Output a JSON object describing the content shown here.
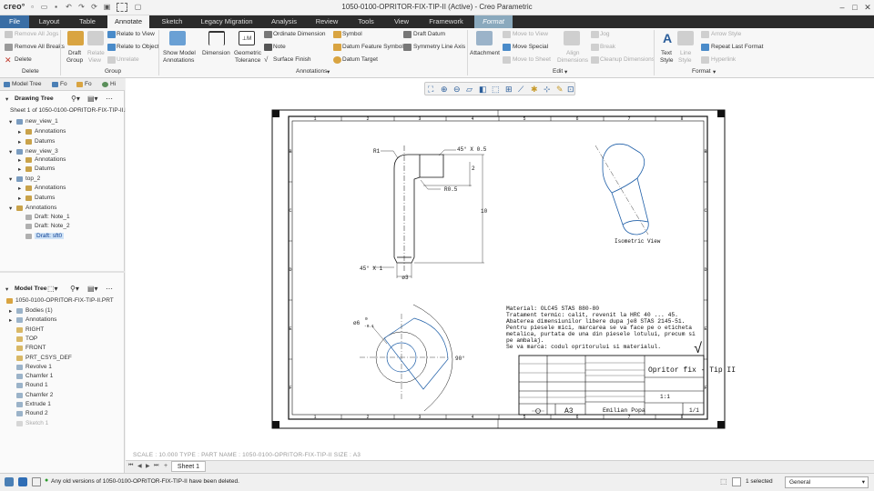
{
  "app": {
    "logo": "creo°",
    "window_title": "1050-0100-OPRITOR-FIX-TIP-II (Active) - Creo Parametric"
  },
  "tabs": [
    "File",
    "Layout",
    "Table",
    "Annotate",
    "Sketch",
    "Legacy Migration",
    "Analysis",
    "Review",
    "Tools",
    "View",
    "Framework",
    "Format"
  ],
  "ribbon": {
    "delete_group": {
      "remove_all_jogs": "Remove All Jogs",
      "remove_all_breaks": "Remove All Breaks",
      "delete": "Delete",
      "label": "Delete"
    },
    "group_group": {
      "draft_group": "Draft",
      "draft_group2": "Group",
      "relate_view": "Relate",
      "relate_view2": "View",
      "relate_to_view": "Relate to View",
      "relate_to_object": "Relate to Object",
      "unrelate": "Unrelate",
      "label": "Group"
    },
    "annotations_group": {
      "show_model": "Show Model",
      "show_model2": "Annotations",
      "dimension": "Dimension",
      "geometric": "Geometric",
      "geometric2": "Tolerance",
      "ordinate_dimension": "Ordinate Dimension",
      "note": "Note",
      "surface_finish": "Surface Finish",
      "symbol": "Symbol",
      "datum_feature_symbol": "Datum Feature Symbol",
      "datum_target": "Datum Target",
      "draft_datum": "Draft Datum",
      "symmetry_line_axis": "Symmetry Line Axis",
      "label": "Annotations"
    },
    "edit_group": {
      "attachment": "Attachment",
      "move_to_view": "Move to View",
      "move_special": "Move Special",
      "move_to_sheet": "Move to Sheet",
      "align": "Align",
      "align2": "Dimensions",
      "jog": "Jog",
      "break": "Break",
      "cleanup_dimensions": "Cleanup Dimensions",
      "label": "Edit"
    },
    "format_group": {
      "text_style": "Text",
      "text_style2": "Style",
      "line_style": "Line",
      "line_style2": "Style",
      "arrow_style": "Arrow Style",
      "repeat_last_format": "Repeat Last Format",
      "hyperlink": "Hyperlink",
      "label": "Format"
    }
  },
  "left_tabs": [
    "Model Tree",
    "Fo",
    "Fo",
    "Hi"
  ],
  "drawing_tree": {
    "title": "Drawing Tree",
    "sheet": "Sheet 1 of 1050-0100-OPRITOR-FIX-TIP-II.DF",
    "items": [
      {
        "label": "new_view_1",
        "indent": 1
      },
      {
        "label": "Annotations",
        "indent": 2
      },
      {
        "label": "Datums",
        "indent": 2
      },
      {
        "label": "new_view_3",
        "indent": 1
      },
      {
        "label": "Annotations",
        "indent": 2
      },
      {
        "label": "Datums",
        "indent": 2
      },
      {
        "label": "top_2",
        "indent": 1
      },
      {
        "label": "Annotations",
        "indent": 2
      },
      {
        "label": "Datums",
        "indent": 2
      },
      {
        "label": "Annotations",
        "indent": 0
      },
      {
        "label": "Draft: Note_1",
        "indent": 2
      },
      {
        "label": "Draft: Note_2",
        "indent": 2
      },
      {
        "label": "Draft: sft0",
        "indent": 2,
        "selected": true
      }
    ]
  },
  "model_tree": {
    "title": "Model Tree",
    "root": "1050-0100-OPRITOR-FIX-TIP-II.PRT",
    "items": [
      {
        "label": "Bodies (1)",
        "disabled": false
      },
      {
        "label": "Annotations",
        "disabled": false
      },
      {
        "label": "RIGHT",
        "disabled": false
      },
      {
        "label": "TOP",
        "disabled": false
      },
      {
        "label": "FRONT",
        "disabled": false
      },
      {
        "label": "PRT_CSYS_DEF",
        "disabled": false
      },
      {
        "label": "Revolve 1",
        "disabled": false
      },
      {
        "label": "Chamfer 1",
        "disabled": false
      },
      {
        "label": "Round 1",
        "disabled": false
      },
      {
        "label": "Chamfer 2",
        "disabled": false
      },
      {
        "label": "Extrude 1",
        "disabled": false
      },
      {
        "label": "Round 2",
        "disabled": false
      },
      {
        "label": "Sketch 1",
        "disabled": true
      }
    ]
  },
  "drawing": {
    "dims": {
      "r1": "R1",
      "chamfer_top": "45° X 0.5",
      "dim_2": "2",
      "r05": "R0.5",
      "dim_10": "10",
      "chamfer_bottom": "45° X 1",
      "dia3": "ø3",
      "dia6": "ø6",
      "tol_up": "0",
      "tol_down": "-0.1",
      "angle": "90°"
    },
    "isometric_label": "Isometric View",
    "notes": [
      "Material: OLC45 STAS 880-80",
      "Tratament termic: calit, revenit la HRC 40 ... 45.",
      "Abaterea dimensiunilor libere dupa je8 STAS 2145-51.",
      "Pentru piesele mici, marcarea se va face pe o eticheta",
      "metalica, purtata de una din piesele lotului, precum si",
      "pe ambalaj.",
      "Se va marca: codul opritorului si materialul."
    ],
    "surface_mark": "√",
    "title_block": {
      "part_name": "Opritor fix - Tip II",
      "author": "Emilian Popa",
      "sheet_size": "A3",
      "scale": "1:1",
      "sheet": "1/1"
    },
    "border": {
      "columns": [
        "1",
        "2",
        "3",
        "4",
        "5",
        "6",
        "7",
        "8"
      ],
      "rows": [
        "B",
        "C",
        "D",
        "E",
        "F"
      ]
    }
  },
  "status": {
    "meta": "SCALE : 10.000   TYPE : PART   NAME : 1050-0100-OPRITOR-FIX-TIP-II   SIZE : A3",
    "sheet_tab": "Sheet 1",
    "message": "Any old versions of 1050-0100-OPRITOR-FIX-TIP-II have been deleted.",
    "selected": "1 selected",
    "filter": "General"
  },
  "colors": {
    "tabbar": "#2b2b2b",
    "file_tab": "#3a6ea5",
    "format_tab": "#8aa9bd",
    "selection": "#1f5fa8"
  }
}
